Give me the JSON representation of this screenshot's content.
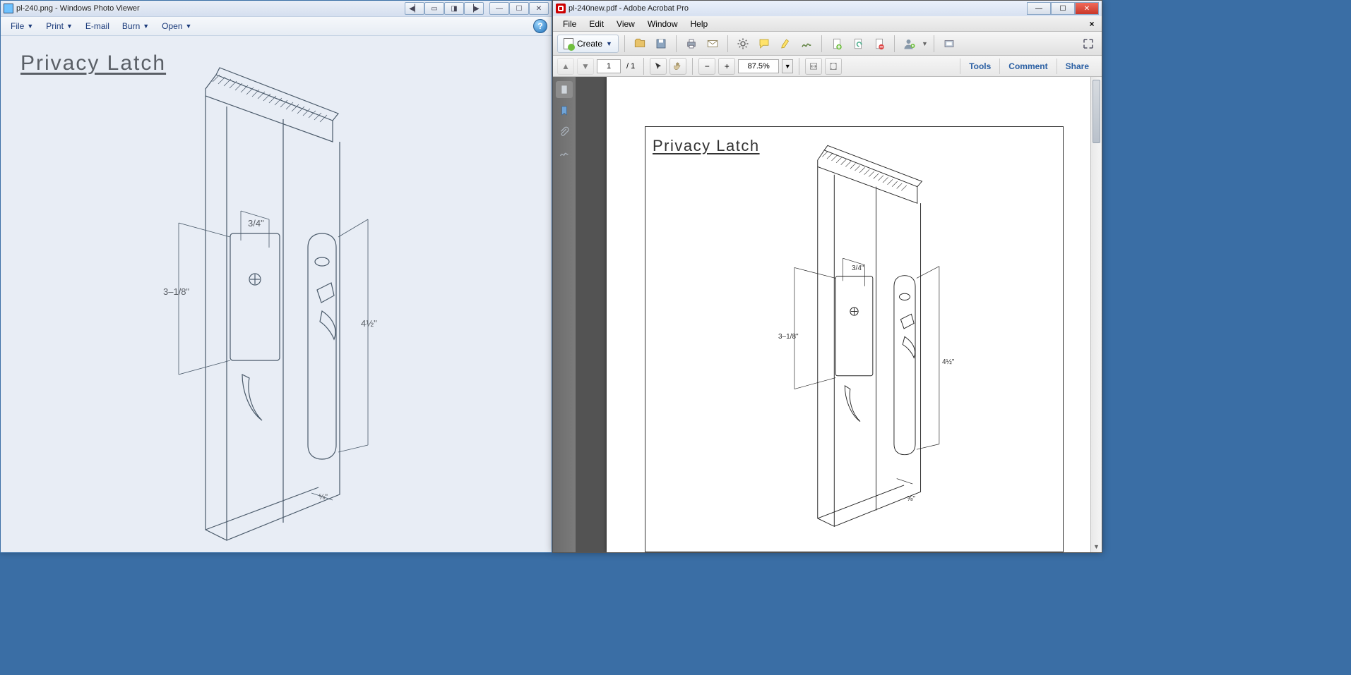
{
  "left": {
    "title": "pl-240.png - Windows Photo Viewer",
    "menu": {
      "file": "File",
      "print": "Print",
      "email": "E-mail",
      "burn": "Burn",
      "open": "Open"
    },
    "drawing": {
      "title": "Privacy Latch",
      "dim_top": "3/4\"",
      "dim_left": "3–1/8\"",
      "dim_right": "4½\"",
      "dim_bottom": "⅝\""
    }
  },
  "right": {
    "title": "pl-240new.pdf - Adobe Acrobat Pro",
    "menu": {
      "file": "File",
      "edit": "Edit",
      "view": "View",
      "window": "Window",
      "help": "Help"
    },
    "create_label": "Create",
    "page_current": "1",
    "page_total": "/ 1",
    "zoom": "87.5%",
    "tabs": {
      "tools": "Tools",
      "comment": "Comment",
      "share": "Share"
    },
    "drawing": {
      "title": "Privacy Latch",
      "dim_top": "3/4\"",
      "dim_left": "3–1/8\"",
      "dim_right": "4½\"",
      "dim_bottom": "⅝\""
    }
  }
}
